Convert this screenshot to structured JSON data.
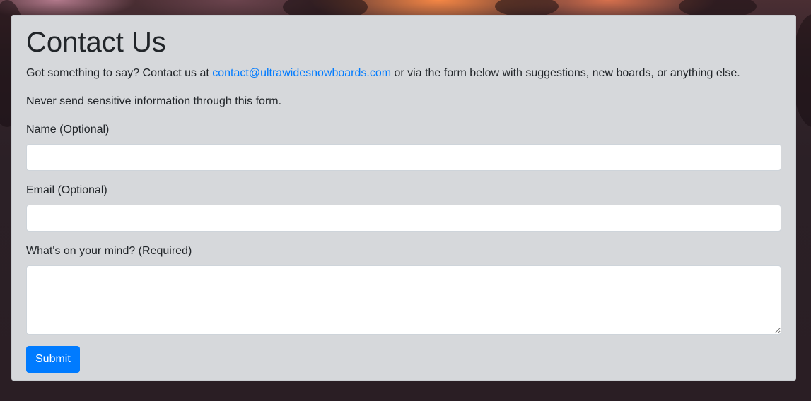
{
  "page": {
    "title": "Contact Us",
    "intro_before": "Got something to say? Contact us at ",
    "email_link": "contact@ultrawidesnowboards.com",
    "intro_after": " or via the form below with suggestions, new boards, or anything else.",
    "warning": "Never send sensitive information through this form."
  },
  "form": {
    "name_label": "Name (Optional)",
    "name_value": "",
    "email_label": "Email (Optional)",
    "email_value": "",
    "message_label": "What's on your mind? (Required)",
    "message_value": "",
    "submit_label": "Submit"
  },
  "colors": {
    "accent": "#007bff",
    "card_background": "#d6d8db"
  }
}
